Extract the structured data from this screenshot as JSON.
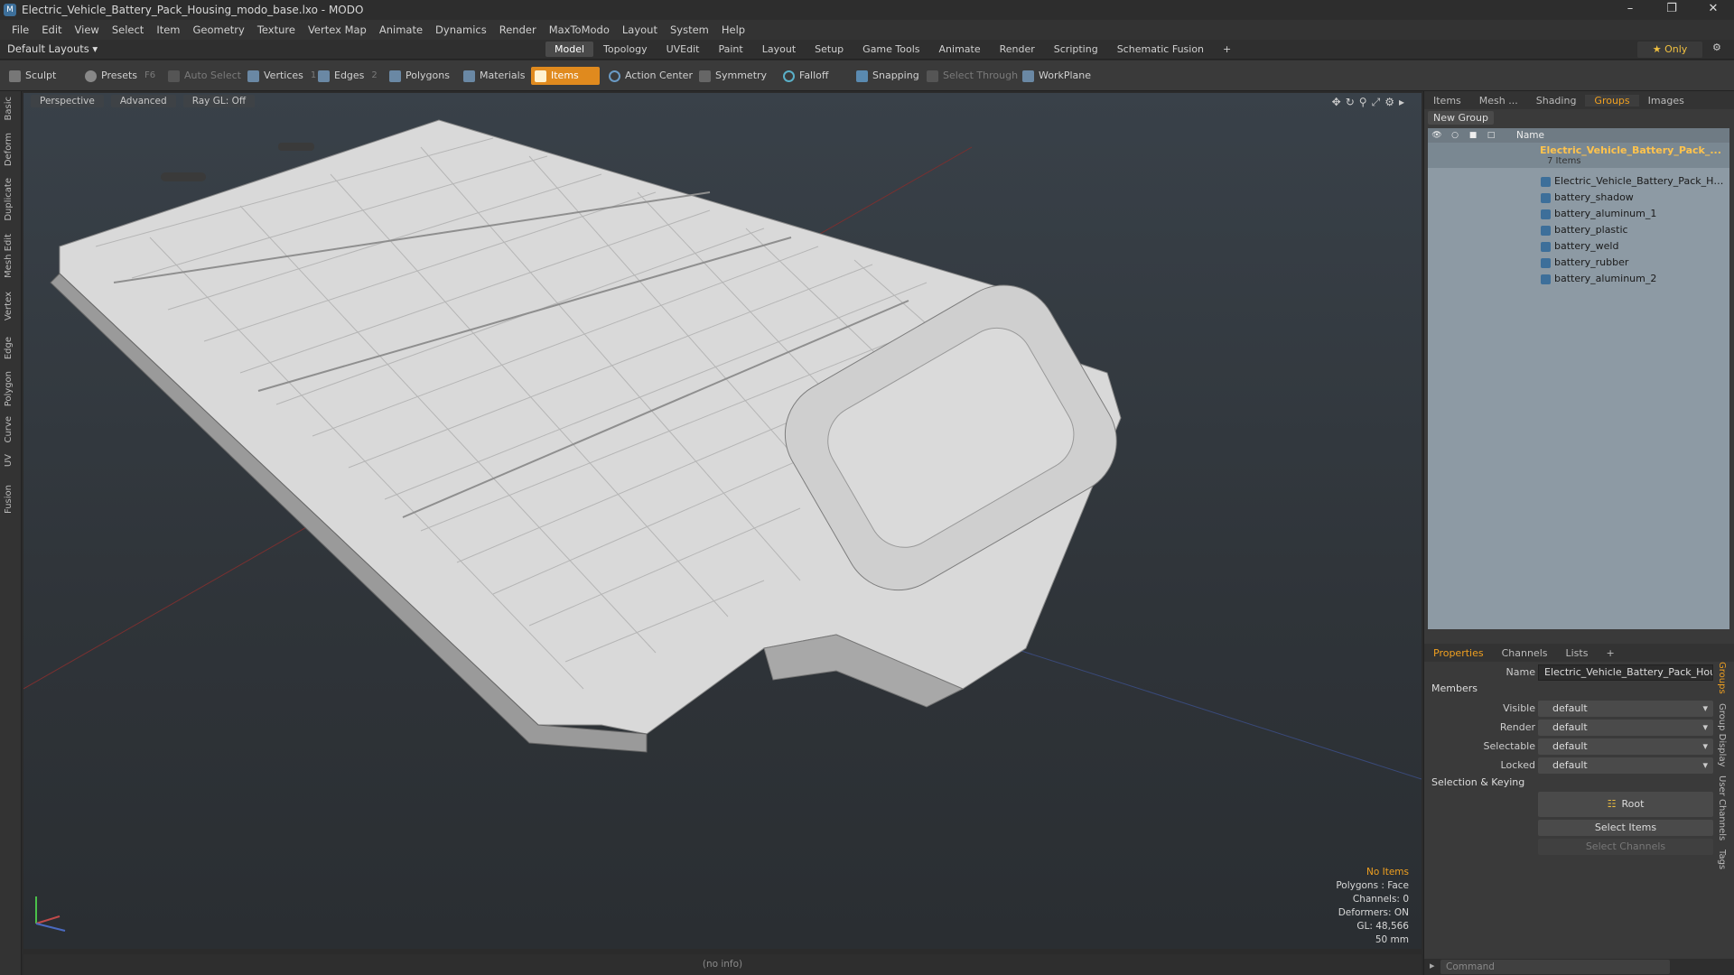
{
  "window": {
    "title": "Electric_Vehicle_Battery_Pack_Housing_modo_base.lxo - MODO"
  },
  "menu": [
    "File",
    "Edit",
    "View",
    "Select",
    "Item",
    "Geometry",
    "Texture",
    "Vertex Map",
    "Animate",
    "Dynamics",
    "Render",
    "MaxToModo",
    "Layout",
    "System",
    "Help"
  ],
  "layout_bar": {
    "layouts_label": "Default Layouts ▾",
    "tabs": [
      "Model",
      "Topology",
      "UVEdit",
      "Paint",
      "Layout",
      "Setup",
      "Game Tools",
      "Animate",
      "Render",
      "Scripting",
      "Schematic Fusion",
      "+"
    ],
    "active_tab": "Model",
    "only_label": "★ Only"
  },
  "toolbar": {
    "sculpt": "Sculpt",
    "presets": "Presets",
    "presets_key": "F6",
    "auto_select": "Auto Select",
    "vertices": "Vertices",
    "vertices_count": "1",
    "edges": "Edges",
    "edges_count": "2",
    "polygons": "Polygons",
    "materials": "Materials",
    "items": "Items",
    "action_center": "Action Center",
    "symmetry": "Symmetry",
    "falloff": "Falloff",
    "snapping": "Snapping",
    "select_through": "Select Through",
    "workplane": "WorkPlane"
  },
  "left_tabs": [
    "Basic",
    "Deform",
    "Duplicate",
    "Mesh Edit",
    "Vertex",
    "Edge",
    "Polygon",
    "Curve",
    "UV",
    "Fusion"
  ],
  "viewport": {
    "view_mode": "Perspective",
    "advanced": "Advanced",
    "raygl": "Ray GL: Off",
    "stats": {
      "no_items": "No Items",
      "polygons": "Polygons : Face",
      "channels": "Channels: 0",
      "deformers": "Deformers: ON",
      "gl": "GL: 48,566",
      "units": "50 mm"
    }
  },
  "status": {
    "info": "(no info)"
  },
  "panel_tabs": [
    "Items",
    "Mesh ...",
    "Shading",
    "Groups",
    "Images"
  ],
  "panel_active": "Groups",
  "groups": {
    "new_group": "New Group",
    "name_header": "Name",
    "group_name": "Electric_Vehicle_Battery_Pack_...",
    "group_count": "7 Items",
    "items": [
      "Electric_Vehicle_Battery_Pack_Housi...",
      "battery_shadow",
      "battery_aluminum_1",
      "battery_plastic",
      "battery_weld",
      "battery_rubber",
      "battery_aluminum_2"
    ]
  },
  "properties": {
    "tabs": [
      "Properties",
      "Channels",
      "Lists",
      "+"
    ],
    "name_label": "Name",
    "name_value": "Electric_Vehicle_Battery_Pack_Housing",
    "members_section": "Members",
    "visible_label": "Visible",
    "visible_value": "default",
    "render_label": "Render",
    "render_value": "default",
    "selectable_label": "Selectable",
    "selectable_value": "default",
    "locked_label": "Locked",
    "locked_value": "default",
    "selkey_section": "Selection & Keying",
    "root_label": "Root",
    "select_items": "Select Items",
    "select_channels": "Select Channels",
    "side_tabs": [
      "Groups",
      "Group Display",
      "User Channels",
      "Tags"
    ]
  },
  "command": {
    "placeholder": "Command"
  }
}
